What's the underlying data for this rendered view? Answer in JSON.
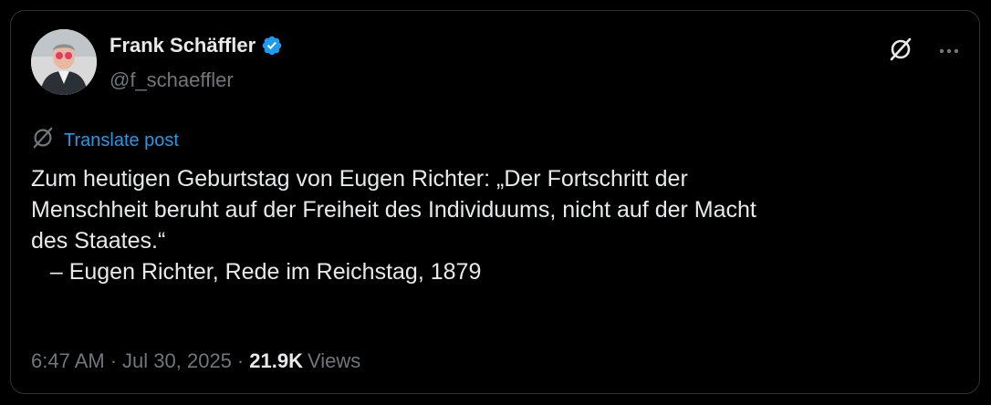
{
  "author": {
    "display_name": "Frank Schäffler",
    "handle": "@f_schaeffler",
    "verified": true
  },
  "icons": {
    "verified": "verified-badge-icon",
    "grok": "grok-icon",
    "more": "more-icon",
    "translate": "grok-translate-icon"
  },
  "colors": {
    "accent": "#1d9bf0",
    "text": "#e7e9ea",
    "secondary": "#71767b",
    "background": "#000000"
  },
  "translate_label": "Translate post",
  "post": {
    "text": "Zum heutigen Geburtstag von Eugen Richter: „Der Fortschritt der\nMenschheit beruht auf der Freiheit des Individuums, nicht auf der Macht\ndes Staates.“\n   – Eugen Richter, Rede im Reichstag, 1879"
  },
  "meta": {
    "time": "6:47 AM",
    "separator": "·",
    "date": "Jul 30, 2025",
    "views_count": "21.9K",
    "views_label": "Views"
  }
}
